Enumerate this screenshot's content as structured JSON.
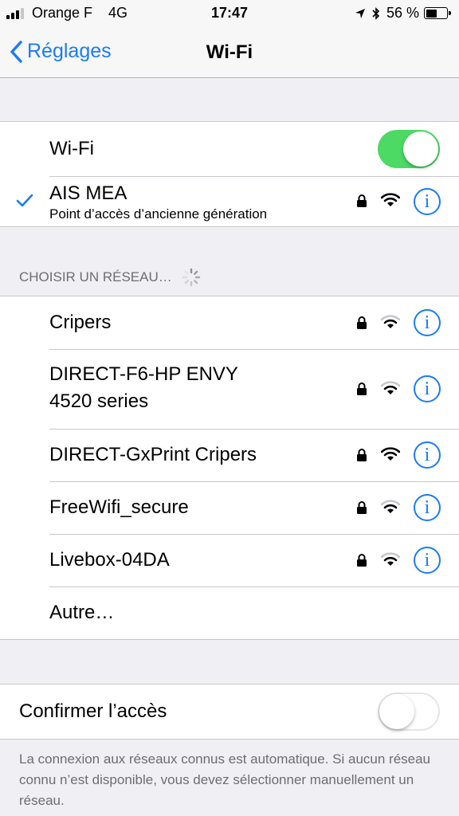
{
  "status_bar": {
    "carrier": "Orange F",
    "network": "4G",
    "time": "17:47",
    "battery_percent": "56 %",
    "battery_level": 0.56,
    "signal_bars": 3,
    "icons": [
      "location-arrow-icon",
      "bluetooth-icon"
    ]
  },
  "nav": {
    "back_label": "Réglages",
    "title": "Wi-Fi"
  },
  "wifi": {
    "label": "Wi-Fi",
    "enabled": true
  },
  "current_network": {
    "name": "AIS MEA",
    "subtitle": "Point d’accès d’ancienne génération",
    "secured": true
  },
  "networks_header": "CHOISIR UN RÉSEAU…",
  "networks": [
    {
      "name": "Cripers",
      "secured": true,
      "signal": 2
    },
    {
      "name_line1": "DIRECT-F6-HP ENVY",
      "name_line2": "4520 series",
      "secured": true,
      "signal": 2
    },
    {
      "name": "DIRECT-GxPrint Cripers",
      "secured": true,
      "signal": 3
    },
    {
      "name": "FreeWifi_secure",
      "secured": true,
      "signal": 2
    },
    {
      "name": "Livebox-04DA",
      "secured": true,
      "signal": 2
    }
  ],
  "other_label": "Autre…",
  "ask_to_join": {
    "label": "Confirmer l’accès",
    "enabled": false
  },
  "footer_text": "La connexion aux réseaux connus est automatique. Si aucun réseau connu n’est disponible, vous devez sélectionner manuellement un réseau.",
  "colors": {
    "accent": "#1a7cf5",
    "toggle_on": "#4cd964",
    "background": "#efeff4"
  }
}
